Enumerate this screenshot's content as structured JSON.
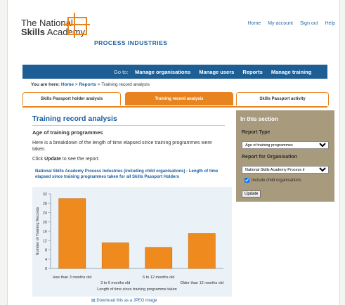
{
  "header": {
    "logo_line1": "The National",
    "logo_line2_bold": "Skills",
    "logo_line2_rest": " Academy",
    "logo_sub": "PROCESS INDUSTRIES",
    "top_links": [
      "Home",
      "My account",
      "Sign out",
      "Help"
    ]
  },
  "nav": {
    "goto_label": "Go to:",
    "links": [
      "Manage organisations",
      "Manage users",
      "Reports",
      "Manage training"
    ]
  },
  "breadcrumb": {
    "prefix": "You are here:",
    "home": "Home",
    "sep1": " > ",
    "reports": "Reports",
    "sep2": " > ",
    "current": "Training record analysis"
  },
  "tabs": [
    "Skills Passport holder analysis",
    "Training record analysis",
    "Skills Passport activity"
  ],
  "main": {
    "title": "Training record analysis",
    "subtitle": "Age of training programmes",
    "description": "Here is a breakdown of the length of time elapsed since training programmes were taken.",
    "click_prefix": "Click ",
    "click_bold": "Update",
    "click_suffix": " to see the report.",
    "download": "Download this as a JPEG image"
  },
  "sidebar": {
    "heading": "In this section",
    "report_type_label": "Report Type",
    "report_type_value": "Age of training programmes",
    "report_org_label": "Report for Organisation",
    "report_org_value": "National Skills Academy Process Ir",
    "include_children": "Include child organisations",
    "update_button": "Update"
  },
  "chart_data": {
    "type": "bar",
    "title": "National Skills Academy Process Industries (including child organisations) - Length of time elapsed since training programmes taken for all Skills Passport Holders",
    "categories": [
      "less than 3 months old",
      "3 to 6 months old",
      "6 to 12 months old",
      "Older than 12 months old"
    ],
    "values": [
      30,
      11,
      9,
      15
    ],
    "xlabel": "Length of time since training programme taken",
    "ylabel": "Number of Training Records",
    "ylim": [
      0,
      32
    ],
    "yticks": [
      0,
      4,
      8,
      12,
      16,
      20,
      24,
      28,
      32
    ],
    "bar_color": "#ef8a1e",
    "grid": false
  }
}
